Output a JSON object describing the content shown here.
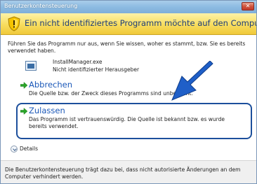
{
  "window": {
    "title": "Benutzerkontensteuerung",
    "close_label": "✕"
  },
  "banner": {
    "text": "Ein nicht identifiziertes Programm möchte auf den Computer zugreifen",
    "color": "#f7dd5e"
  },
  "intro": {
    "text": "Führen Sie das Programm nur aus, wenn Sie wissen, woher es stammt, bzw. Sie es bereits verwendet haben."
  },
  "program": {
    "name": "InstallManager.exe",
    "publisher": "Nicht identifizierter Herausgeber"
  },
  "options": [
    {
      "title": "Abbrechen",
      "description": "Die Quelle bzw. der Zweck dieses Programms sind unbekannt."
    },
    {
      "title": "Zulassen",
      "description": "Das Programm ist vertrauenswürdig. Die Quelle ist bekannt bzw. es wurde bereits verwendet."
    }
  ],
  "details": {
    "label": "Details"
  },
  "footer": {
    "text": "Die Benutzerkontensteuerung trägt dazu bei, dass nicht autorisierte Änderungen an dem Computer verhindert werden."
  },
  "colors": {
    "accent": "#1b58b8",
    "highlight": "#1c4f9c"
  }
}
